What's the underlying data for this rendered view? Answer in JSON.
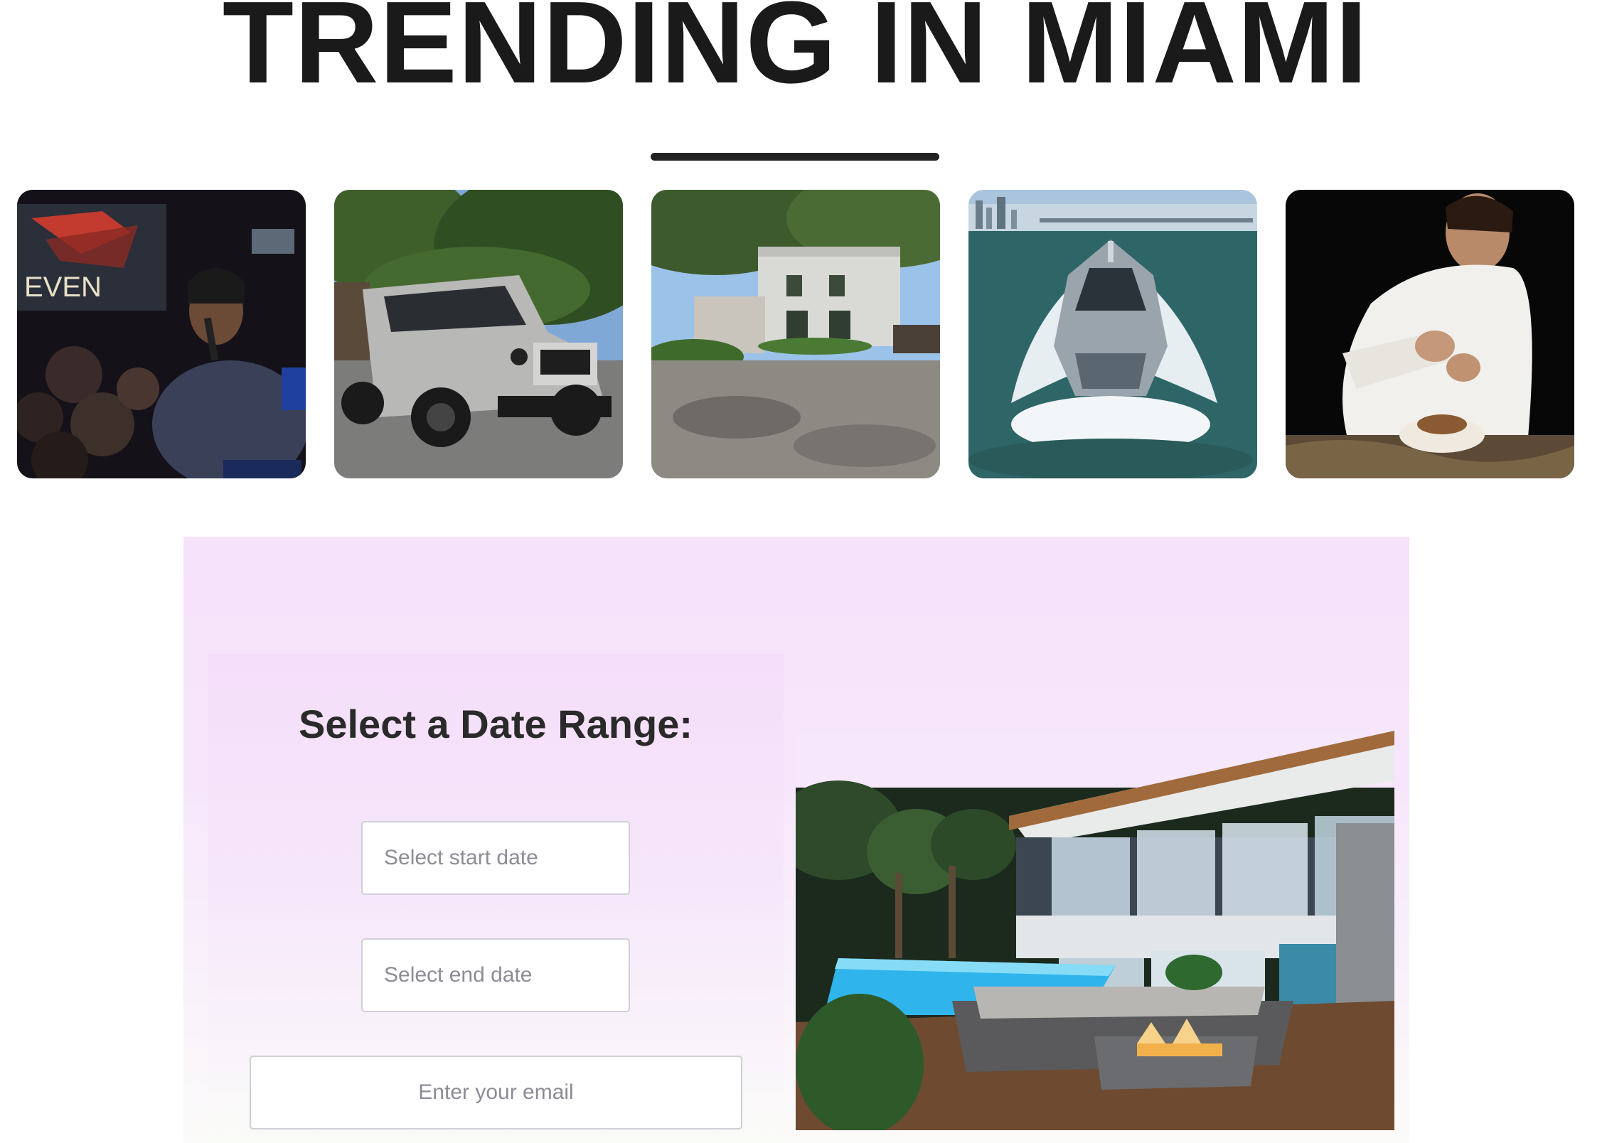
{
  "header": {
    "title": "TRENDING IN MIAMI"
  },
  "gallery": {
    "items": [
      {
        "icon": "concert-image"
      },
      {
        "icon": "suv-image"
      },
      {
        "icon": "house-image"
      },
      {
        "icon": "yacht-image"
      },
      {
        "icon": "chef-image"
      }
    ]
  },
  "booking": {
    "title": "Select a Date Range:",
    "start_placeholder": "Select start date",
    "start_value": "",
    "end_placeholder": "Select end date",
    "end_value": "",
    "email_placeholder": "Enter your email",
    "email_value": "",
    "image": "villa-pool-image"
  },
  "colors": {
    "title": "#1a1a1a",
    "panel_top": "#f6e2fb",
    "panel_bottom": "#fbfbf9",
    "field_border": "#cfcfd6"
  }
}
